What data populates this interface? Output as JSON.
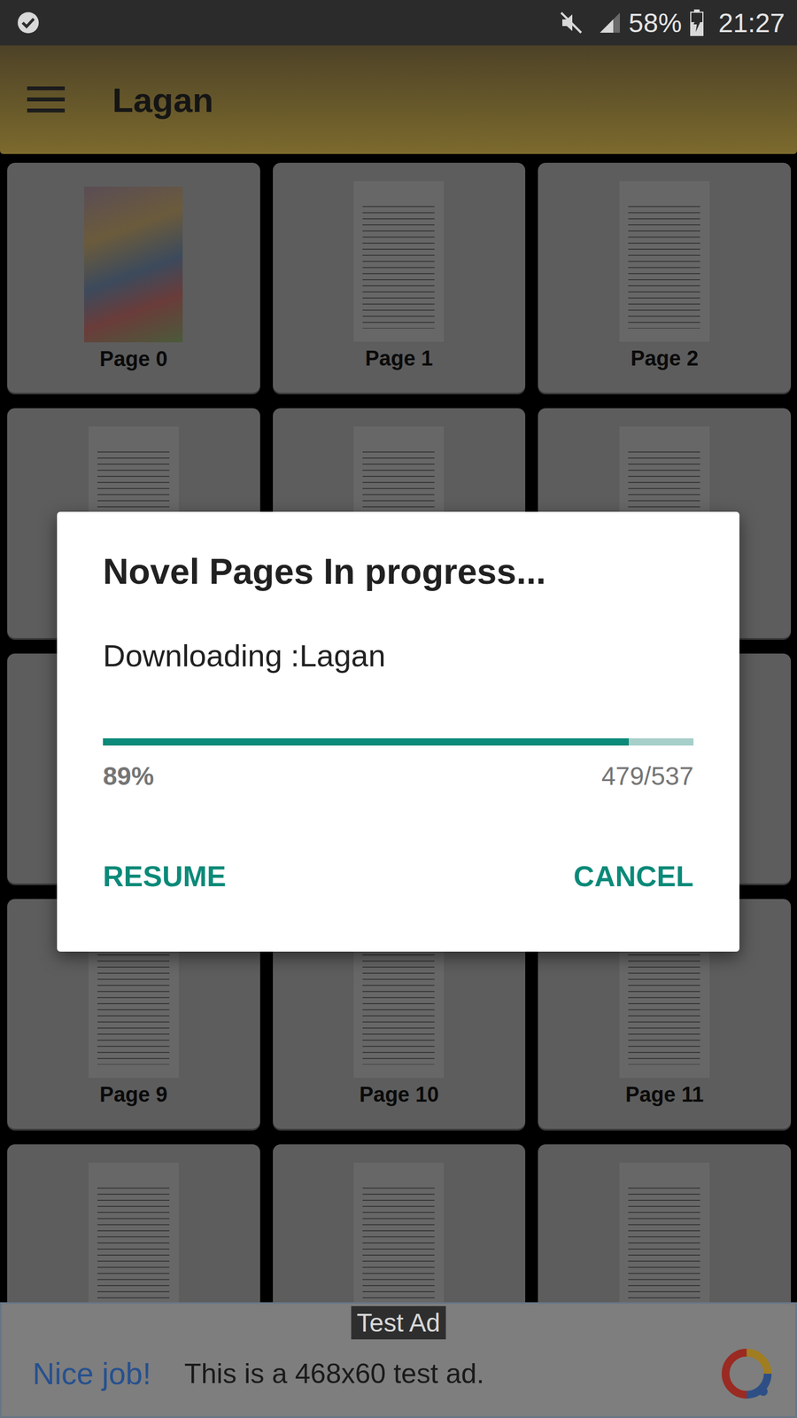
{
  "status_bar": {
    "time": "21:27",
    "battery": "58%",
    "battery_level": 0.58,
    "charging": true,
    "sound_muted": true
  },
  "app_bar": {
    "title": "Lagan"
  },
  "pages": [
    {
      "kind": "cover",
      "label": "Page 0"
    },
    {
      "kind": "page",
      "label": "Page 1"
    },
    {
      "kind": "page",
      "label": "Page 2"
    },
    {
      "kind": "page"
    },
    {
      "kind": "page"
    },
    {
      "kind": "page"
    },
    {
      "kind": "page"
    },
    {
      "kind": "page"
    },
    {
      "kind": "page"
    },
    {
      "kind": "page",
      "label": "Page 9"
    },
    {
      "kind": "page",
      "label": "Page 10"
    },
    {
      "kind": "page",
      "label": "Page 11"
    },
    {
      "kind": "page"
    },
    {
      "kind": "page"
    },
    {
      "kind": "page"
    }
  ],
  "dialog": {
    "title": "Novel Pages In progress...",
    "message": "Downloading :Lagan",
    "progress": {
      "level": 0.89,
      "percent": "89%",
      "count": "479/537"
    },
    "buttons": [
      {
        "label": "RESUME"
      },
      {
        "label": "CANCEL"
      }
    ]
  },
  "ad": {
    "badge": "Test Ad",
    "headline": "Nice job!",
    "text": "This is a 468x60 test ad."
  }
}
